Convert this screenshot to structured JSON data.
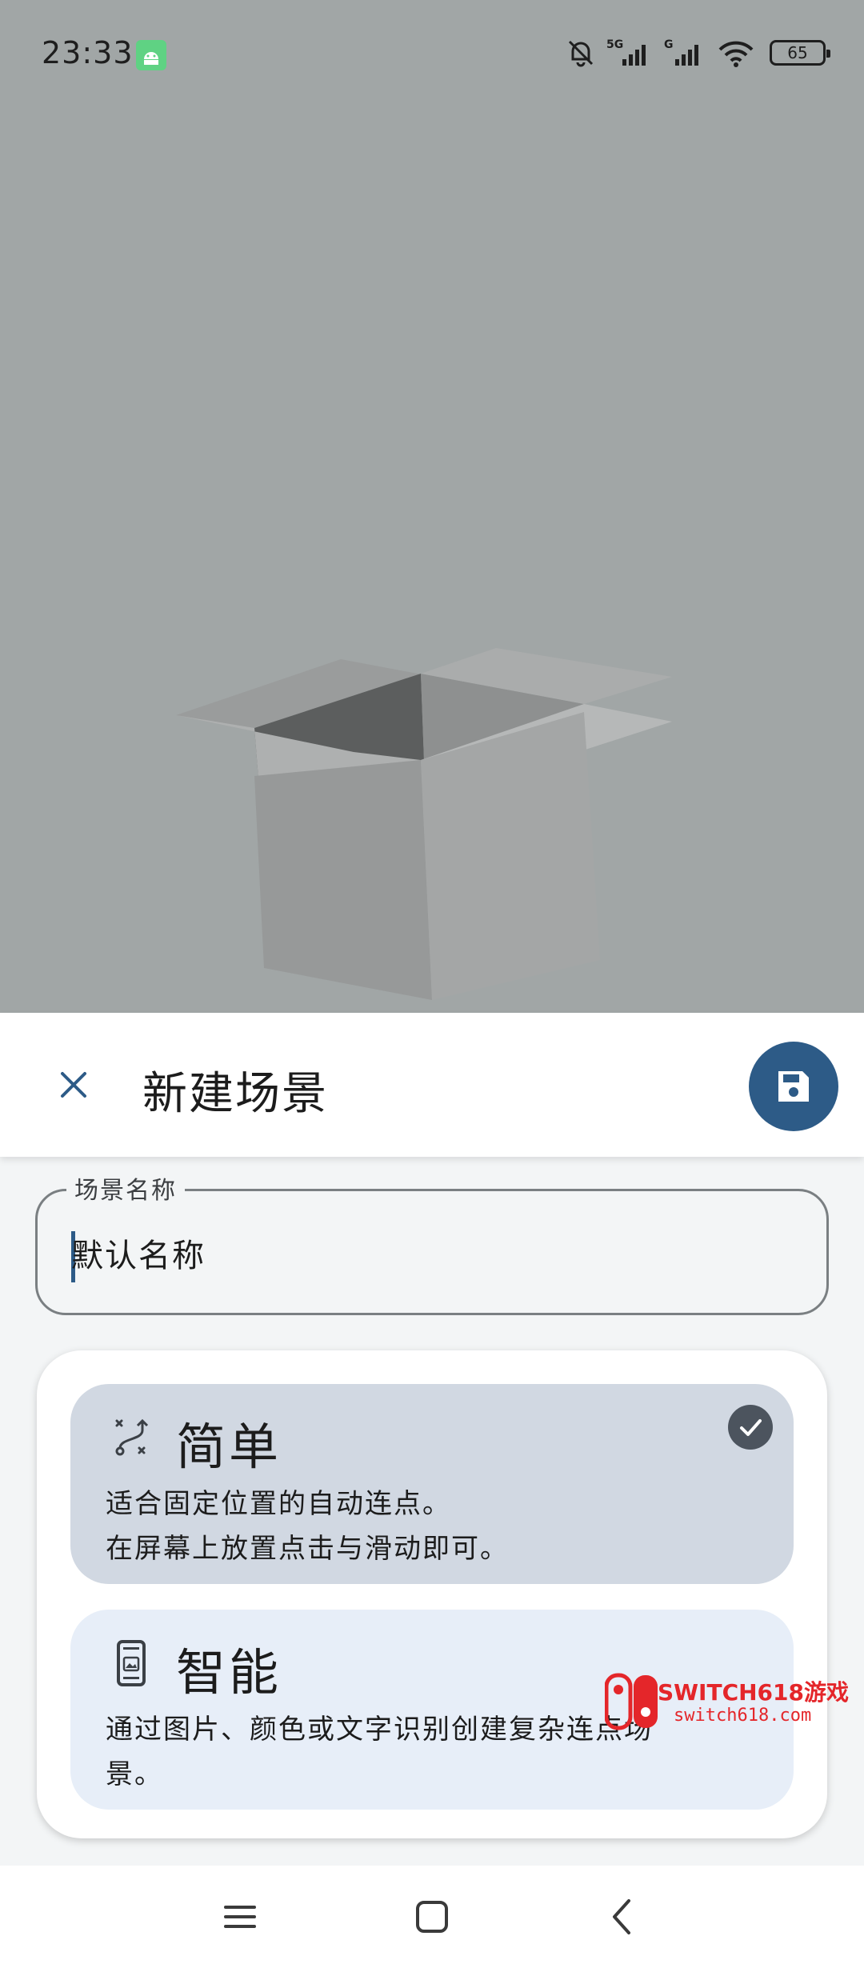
{
  "status_bar": {
    "time": "23:33",
    "network_labels": [
      "5G",
      "G"
    ],
    "battery_level": "65"
  },
  "sheet": {
    "title": "新建场景",
    "close_icon": "close-icon",
    "save_icon": "save-icon"
  },
  "name_field": {
    "label": "场景名称",
    "value": "默认名称"
  },
  "options": [
    {
      "title": "简单",
      "description_line1": "适合固定位置的自动连点。",
      "description_line2": "在屏幕上放置点击与滑动即可。",
      "icon": "route-icon",
      "selected": true
    },
    {
      "title": "智能",
      "description_line1": "通过图片、颜色或文字识别创建复杂连点场",
      "description_line2": "景。",
      "icon": "phone-image-icon",
      "selected": false
    }
  ],
  "watermark": {
    "line1": "SWITCH618游戏",
    "line2": "switch618.com"
  },
  "colors": {
    "accent": "#2d5b87",
    "selected_option_bg": "#d1d8e2",
    "option_bg": "#e7eef8",
    "backdrop": "#a1a6a6"
  }
}
